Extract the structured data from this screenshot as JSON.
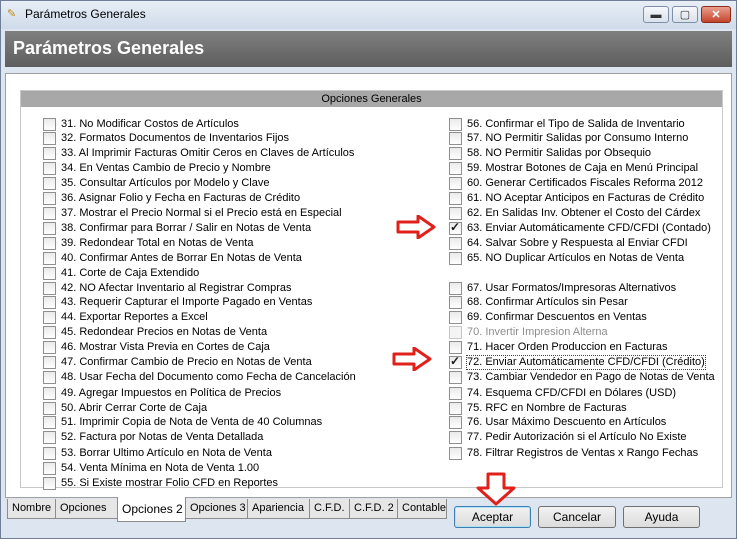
{
  "window": {
    "title": "Parámetros Generales",
    "controls": {
      "minimize": "▬",
      "maximize": "▢",
      "close": "✕"
    }
  },
  "header": {
    "title": "Parámetros Generales"
  },
  "group": {
    "title": "Opciones Generales"
  },
  "left_options": [
    {
      "label": "31. No Modificar Costos de Artículos",
      "checked": false
    },
    {
      "label": "32. Formatos Documentos de Inventarios Fijos",
      "checked": false
    },
    {
      "label": "33. Al Imprimir Facturas Omitir Ceros en Claves de Artículos",
      "checked": false
    },
    {
      "label": "34. En Ventas Cambio de Precio y Nombre",
      "checked": false
    },
    {
      "label": "35. Consultar Artículos por  Modelo y Clave",
      "checked": false
    },
    {
      "label": "36. Asignar Folio y Fecha en Facturas de Crédito",
      "checked": false
    },
    {
      "label": "37. Mostrar el Precio Normal si el Precio está en Especial",
      "checked": false
    },
    {
      "label": "38. Confirmar para Borrar / Salir en Notas de Venta",
      "checked": false
    },
    {
      "label": "39. Redondear Total  en Notas de Venta",
      "checked": false
    },
    {
      "label": "40. Confirmar Antes de Borrar En Notas de Venta",
      "checked": false
    },
    {
      "label": "41. Corte de Caja Extendido",
      "checked": false
    },
    {
      "label": "42. NO Afectar Inventario al Registrar Compras",
      "checked": false
    },
    {
      "label": "43. Requerir Capturar el Importe Pagado en Ventas",
      "checked": false
    },
    {
      "label": "44. Exportar Reportes a Excel",
      "checked": false
    },
    {
      "label": "45. Redondear Precios en Notas de Venta",
      "checked": false
    },
    {
      "label": "46. Mostrar Vista Previa en Cortes de Caja",
      "checked": false
    },
    {
      "label": "47. Confirmar Cambio de Precio en Notas de Venta",
      "checked": false
    },
    {
      "label": "48. Usar Fecha del Documento como Fecha de Cancelación",
      "checked": false
    },
    {
      "label": "49. Agregar Impuestos en Política de Precios",
      "checked": false
    },
    {
      "label": "50. Abrir Cerrar Corte de Caja",
      "checked": false
    },
    {
      "label": "51. Imprimir Copia de Nota de Venta de 40 Columnas",
      "checked": false
    },
    {
      "label": "52. Factura por Notas de Venta Detallada",
      "checked": false
    },
    {
      "label": "53. Borrar Ultimo Artículo en Nota de Venta",
      "checked": false
    },
    {
      "label": "54. Venta Mínima en Nota de Venta 1.00",
      "checked": false
    },
    {
      "label": "55. Si Existe mostrar Folio CFD en Reportes",
      "checked": false
    }
  ],
  "right_options": [
    {
      "label": "56. Confirmar el  Tipo de Salida de Inventario",
      "checked": false
    },
    {
      "label": "57. NO Permitir Salidas por Consumo Interno",
      "checked": false
    },
    {
      "label": "58. NO Permitir Salidas por Obsequio",
      "checked": false
    },
    {
      "label": "59. Mostrar Botones de Caja en Menú Principal",
      "checked": false
    },
    {
      "label": "60. Generar Certificados Fiscales Reforma 2012",
      "checked": false
    },
    {
      "label": "61. NO Aceptar Anticipos en Facturas de Crédito",
      "checked": false
    },
    {
      "label": "62. En Salidas Inv.  Obtener el  Costo del Cárdex",
      "checked": false
    },
    {
      "label": "63. Enviar  Automáticamente  CFD/CFDI (Contado)",
      "checked": true
    },
    {
      "label": "64. Salvar Sobre y Respuesta al Enviar CFDI",
      "checked": false
    },
    {
      "label": "65. NO Duplicar Artículos en Notas de Venta",
      "checked": false
    },
    {
      "label": "67. Usar Formatos/Impresoras Alternativos",
      "checked": false
    },
    {
      "label": "68. Confirmar Artículos sin Pesar",
      "checked": false
    },
    {
      "label": "69. Confirmar Descuentos en Ventas",
      "checked": false
    },
    {
      "label": "70. Invertir Impresion Alterna",
      "checked": false,
      "disabled": true
    },
    {
      "label": "71. Hacer Orden Produccion en Facturas",
      "checked": false
    },
    {
      "label": "72. Enviar  Automáticamente  CFD/CFDI (Crédito)",
      "checked": true,
      "focused": true
    },
    {
      "label": "73. Cambiar Vendedor en Pago de Notas de Venta",
      "checked": false
    },
    {
      "label": "74. Esquema CFD/CFDI en Dólares (USD)",
      "checked": false
    },
    {
      "label": "75. RFC en Nombre de Facturas",
      "checked": false
    },
    {
      "label": "76. Usar Máximo Descuento en Artículos",
      "checked": false
    },
    {
      "label": "77. Pedir Autorización si el Artículo No Existe",
      "checked": false
    },
    {
      "label": "78. Filtrar Registros de Ventas x Rango Fechas",
      "checked": false
    }
  ],
  "tabs": [
    {
      "label": "Nombre",
      "active": false
    },
    {
      "label": "Opciones",
      "active": false
    },
    {
      "label": "Opciones 2",
      "active": true
    },
    {
      "label": "Opciones 3",
      "active": false
    },
    {
      "label": "Apariencia",
      "active": false
    },
    {
      "label": "C.F.D.",
      "active": false
    },
    {
      "label": "C.F.D. 2",
      "active": false
    },
    {
      "label": "Contable",
      "active": false
    }
  ],
  "buttons": {
    "accept": "Aceptar",
    "cancel": "Cancelar",
    "help": "Ayuda"
  },
  "colors": {
    "arrow": "#e0201a",
    "header_bg": "#6e6e6e",
    "group_header_bg": "#a8a8a8"
  }
}
